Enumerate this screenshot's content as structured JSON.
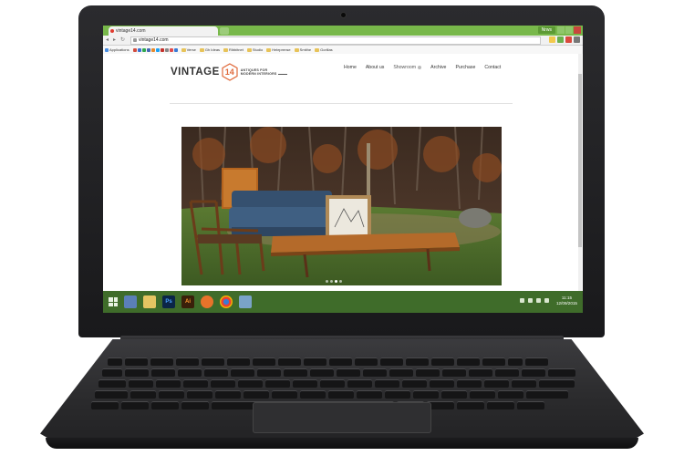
{
  "browser": {
    "tab_title": "vintage14.com",
    "url": "vintage14.com",
    "user_label": "Nrws",
    "bookmarks": [
      "Applications",
      "Verse",
      "Gh Ideas",
      "Ribbitnet",
      "Studio",
      "Heleprense",
      "Smithe",
      "Gorillas"
    ]
  },
  "site": {
    "logo_word": "VINTAGE",
    "logo_number": "14",
    "tagline_line1": "ANTIQUES FOR",
    "tagline_line2": "MODERN INTERIORS",
    "nav": [
      {
        "label": "Home"
      },
      {
        "label": "About us"
      },
      {
        "label": "Showroom"
      },
      {
        "label": "Archive"
      },
      {
        "label": "Purchase"
      },
      {
        "label": "Contact"
      }
    ],
    "hero_alt": "Vintage furniture outdoors",
    "slide_count": 4,
    "active_slide": 3
  },
  "taskbar": {
    "apps": [
      "explorer",
      "folder",
      "PS",
      "AI",
      "firefox",
      "chrome",
      "box"
    ],
    "time": "11:15",
    "date": "12/09/2015"
  },
  "colors": {
    "chrome_accent": "#78b84a",
    "taskbar": "#3f6c2a",
    "logo_orange": "#e06a3b"
  }
}
